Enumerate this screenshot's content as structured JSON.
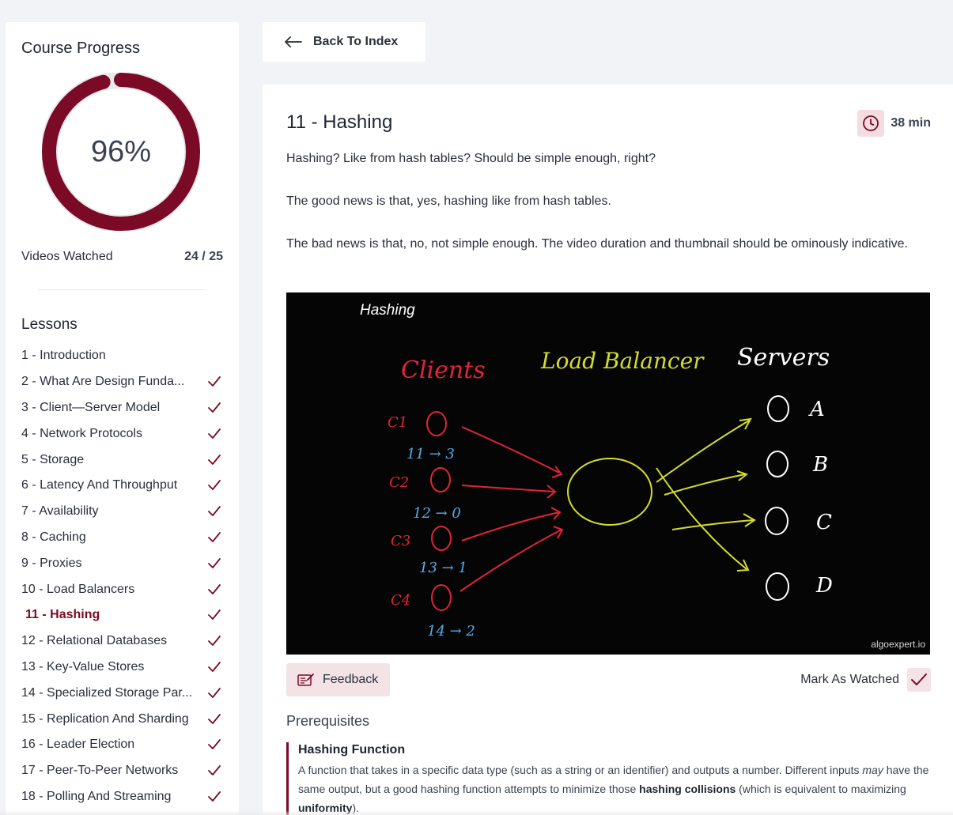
{
  "sidebar": {
    "title": "Course Progress",
    "progress_fraction": 0.96,
    "progress_label": "96%",
    "videos_label": "Videos Watched",
    "videos_count": "24 / 25",
    "lessons_title": "Lessons",
    "lessons": [
      {
        "label": "1 - Introduction",
        "watched": false,
        "active": false
      },
      {
        "label": "2 - What Are Design Funda...",
        "watched": true,
        "active": false
      },
      {
        "label": "3 - Client—Server Model",
        "watched": true,
        "active": false
      },
      {
        "label": "4 - Network Protocols",
        "watched": true,
        "active": false
      },
      {
        "label": "5 - Storage",
        "watched": true,
        "active": false
      },
      {
        "label": "6 - Latency And Throughput",
        "watched": true,
        "active": false
      },
      {
        "label": "7 - Availability",
        "watched": true,
        "active": false
      },
      {
        "label": "8 - Caching",
        "watched": true,
        "active": false
      },
      {
        "label": "9 - Proxies",
        "watched": true,
        "active": false
      },
      {
        "label": "10 - Load Balancers",
        "watched": true,
        "active": false
      },
      {
        "label": "11 - Hashing",
        "watched": true,
        "active": true
      },
      {
        "label": "12 - Relational Databases",
        "watched": true,
        "active": false
      },
      {
        "label": "13 - Key-Value Stores",
        "watched": true,
        "active": false
      },
      {
        "label": "14 - Specialized Storage Par...",
        "watched": true,
        "active": false
      },
      {
        "label": "15 - Replication And Sharding",
        "watched": true,
        "active": false
      },
      {
        "label": "16 - Leader Election",
        "watched": true,
        "active": false
      },
      {
        "label": "17 - Peer-To-Peer Networks",
        "watched": true,
        "active": false
      },
      {
        "label": "18 - Polling And Streaming",
        "watched": true,
        "active": false
      }
    ]
  },
  "back_button": {
    "label": "Back To Index",
    "icon": "arrow-left-icon"
  },
  "main": {
    "title": "11 - Hashing",
    "duration": "38 min",
    "duration_icon": "clock-icon",
    "paragraphs": [
      "Hashing? Like from hash tables? Should be simple enough, right?",
      "The good news is that, yes, hashing like from hash tables.",
      "The bad news is that, no, not simple enough. The video duration and thumbnail should be ominously indicative."
    ],
    "video": {
      "title": "Hashing",
      "watermark": "algoexpert.io",
      "labels": {
        "clients": "Clients",
        "load_balancer": "Load Balancer",
        "servers": "Servers",
        "client_names": [
          "C1",
          "C2",
          "C3",
          "C4"
        ],
        "client_mappings": [
          "11 → 3",
          "12 → 0",
          "13 → 1",
          "14 → 2"
        ],
        "server_names": [
          "A",
          "B",
          "C",
          "D"
        ]
      }
    },
    "feedback_label": "Feedback",
    "mark_watched_label": "Mark As Watched",
    "prerequisites_title": "Prerequisites",
    "prerequisite": {
      "name": "Hashing Function",
      "desc_1": "A function that takes in a specific data type (such as a string or an identifier) and outputs a number. Different inputs ",
      "desc_em": "may",
      "desc_2": " have the same output, but a good hashing function attempts to minimize those ",
      "desc_b1": "hashing collisions",
      "desc_3": " (which is equivalent to maximizing ",
      "desc_b2": "uniformity",
      "desc_4": ")."
    }
  },
  "colors": {
    "accent": "#7a0a26",
    "accent_light": "#f3e2e6",
    "clients": "#e0243a",
    "load_balancer": "#d4de2a",
    "servers": "#ffffff",
    "mappings": "#5aa9e6"
  }
}
